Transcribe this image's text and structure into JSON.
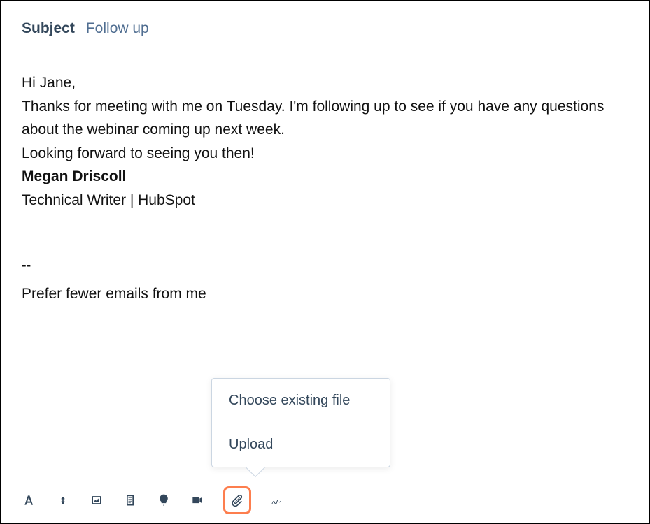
{
  "subject": {
    "label": "Subject",
    "value": "Follow up"
  },
  "body": {
    "greeting": "Hi Jane,",
    "paragraph1": "Thanks for meeting with me on Tuesday. I'm following up to see if you have any questions about the webinar coming up next week.",
    "paragraph2": "Looking forward to seeing you then!",
    "signature_name": "Megan Driscoll",
    "signature_title": "Technical Writer | HubSpot",
    "separator": "--",
    "footer_truncated": "Prefer fewer emails from me"
  },
  "popover": {
    "choose_existing": "Choose existing file",
    "upload": "Upload"
  },
  "toolbar_icons": {
    "format": "text-format-icon",
    "link": "link-icon",
    "image": "image-icon",
    "document": "document-icon",
    "knowledge": "lightbulb-icon",
    "video": "video-icon",
    "attachment": "attachment-icon",
    "signature": "signature-icon"
  }
}
